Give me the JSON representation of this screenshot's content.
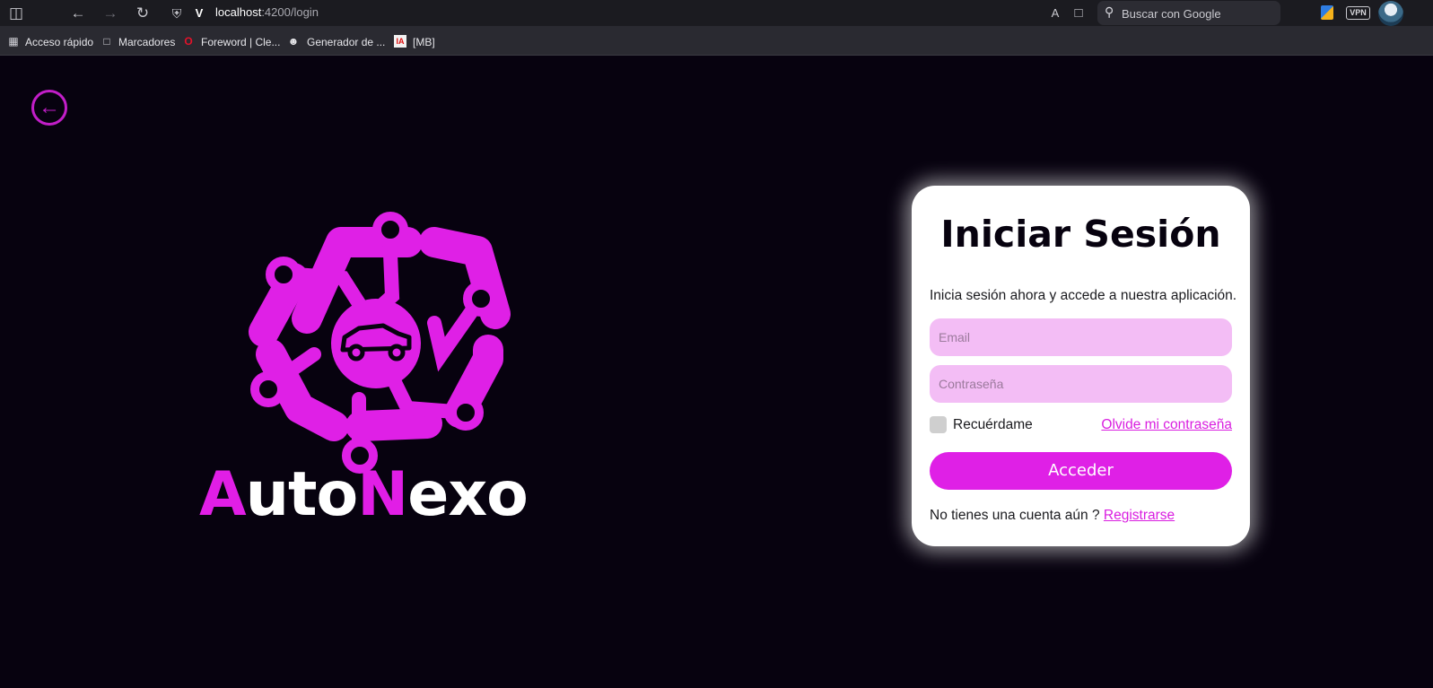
{
  "browser": {
    "url_host": "localhost",
    "url_path": ":4200/login",
    "search_placeholder": "Buscar con Google",
    "vpn_label": "VPN",
    "bookmarks": [
      {
        "label": "Acceso rápido",
        "icon": "grid-folder-icon"
      },
      {
        "label": "Marcadores",
        "icon": "folder-icon"
      },
      {
        "label": "Foreword | Cle...",
        "icon": "opera-icon"
      },
      {
        "label": "Generador de ...",
        "icon": "face-icon"
      },
      {
        "label": "[MB]",
        "icon": "mb-icon"
      }
    ]
  },
  "page": {
    "brand_a": "A",
    "brand_uto": "uto",
    "brand_n": "N",
    "brand_exo": "exo",
    "accent_color": "#df20e6",
    "background_color": "#07020f"
  },
  "login": {
    "title": "Iniciar Sesión",
    "subtitle": "Inicia sesión ahora y accede a nuestra aplicación.",
    "email_placeholder": "Email",
    "password_placeholder": "Contraseña",
    "remember_label": "Recuérdame",
    "forgot_label": "Olvide mi contraseña",
    "submit_label": "Acceder",
    "no_account_text": "No tienes una cuenta aún ?",
    "register_label": "Registrarse"
  }
}
